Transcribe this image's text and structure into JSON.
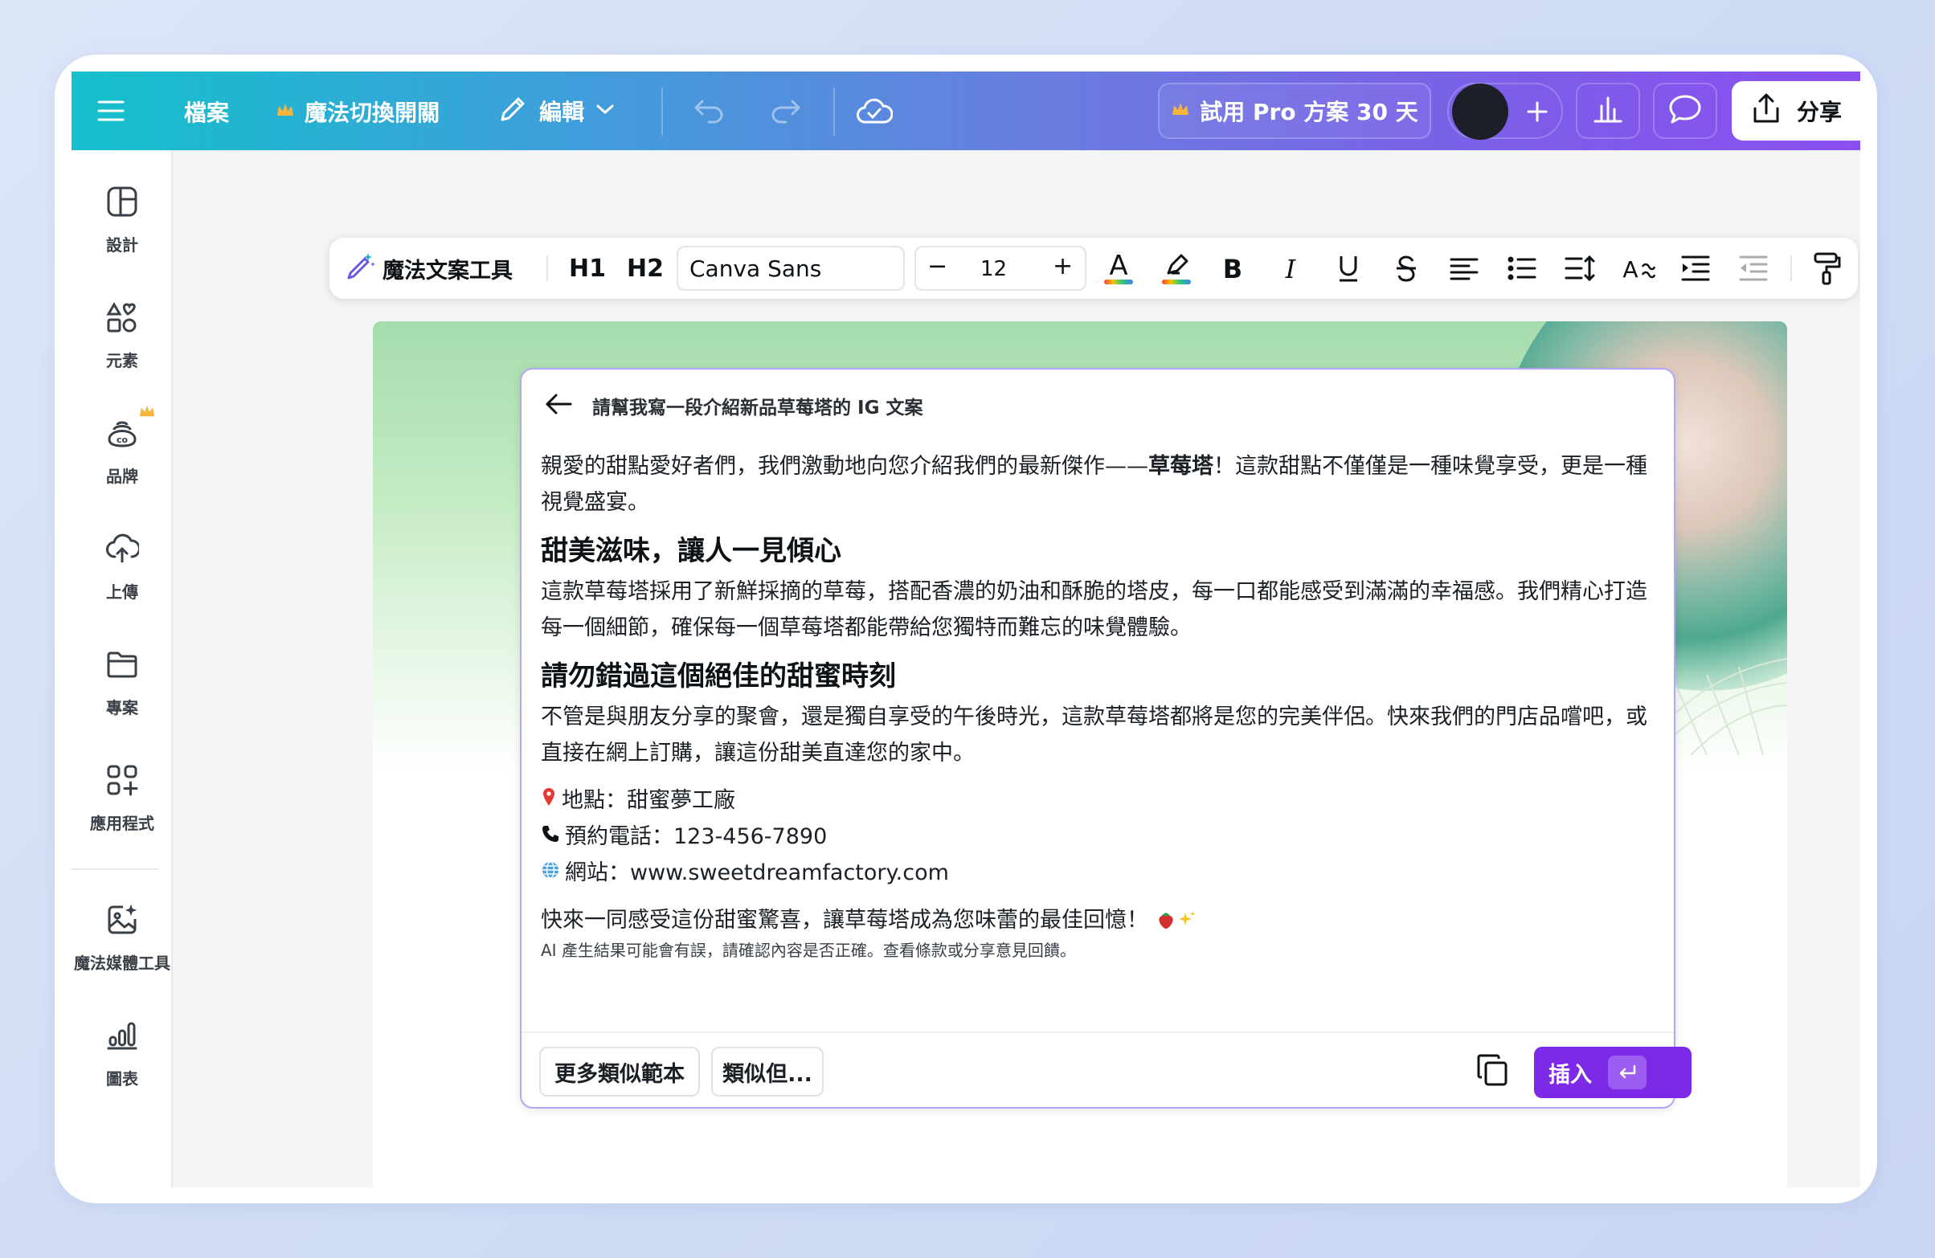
{
  "topbar": {
    "file_label": "檔案",
    "magic_switch_label": "魔法切換開關",
    "edit_label": "編輯",
    "trial_label": "試用 Pro 方案 30 天",
    "share_label": "分享"
  },
  "sidebar": {
    "items": [
      {
        "label": "設計",
        "icon": "layout-icon"
      },
      {
        "label": "元素",
        "icon": "shapes-icon"
      },
      {
        "label": "品牌",
        "icon": "brand-icon"
      },
      {
        "label": "上傳",
        "icon": "cloud-upload-icon"
      },
      {
        "label": "專案",
        "icon": "folder-icon"
      },
      {
        "label": "應用程式",
        "icon": "apps-icon"
      },
      {
        "label": "魔法媒體工具",
        "icon": "magic-media-icon"
      },
      {
        "label": "圖表",
        "icon": "chart-icon"
      }
    ]
  },
  "toolbar": {
    "magic_write_label": "魔法文案工具",
    "h1_label": "H1",
    "h2_label": "H2",
    "font_name": "Canva Sans",
    "font_size": "12",
    "minus": "−",
    "plus": "+"
  },
  "dialog": {
    "title": "請幫我寫一段介紹新品草莓塔的 IG 文案",
    "intro_before": "親愛的甜點愛好者們，我們激動地向您介紹我們的最新傑作——",
    "intro_bold": "草莓塔",
    "intro_after": "！這款甜點不僅僅是一種味覺享受，更是一種視覺盛宴。",
    "heading1": "甜美滋味，讓人一見傾心",
    "para1": "這款草莓塔採用了新鮮採摘的草莓，搭配香濃的奶油和酥脆的塔皮，每一口都能感受到滿滿的幸福感。我們精心打造每一個細節，確保每一個草莓塔都能帶給您獨特而難忘的味覺體驗。",
    "heading2": "請勿錯過這個絕佳的甜蜜時刻",
    "para2": "不管是與朋友分享的聚會，還是獨自享受的午後時光，這款草莓塔都將是您的完美伴侶。快來我們的門店品嚐吧，或直接在網上訂購，讓這份甜美直達您的家中。",
    "location": "地點：甜蜜夢工廠",
    "phone": "預約電話：123-456-7890",
    "website": "網站：www.sweetdreamfactory.com",
    "closing": "快來一同感受這份甜蜜驚喜，讓草莓塔成為您味蕾的最佳回憶！",
    "disclaimer": "AI 產生結果可能會有誤，請確認內容是否正確。查看條款或分享意見回饋。",
    "more_examples_label": "更多類似範本",
    "similar_label": "類似但...",
    "insert_label": "插入"
  },
  "colors": {
    "accent": "#7d2ae8",
    "topbar_start": "#14c0cb",
    "topbar_end": "#8a4ff0",
    "crown": "#f5b53b"
  }
}
